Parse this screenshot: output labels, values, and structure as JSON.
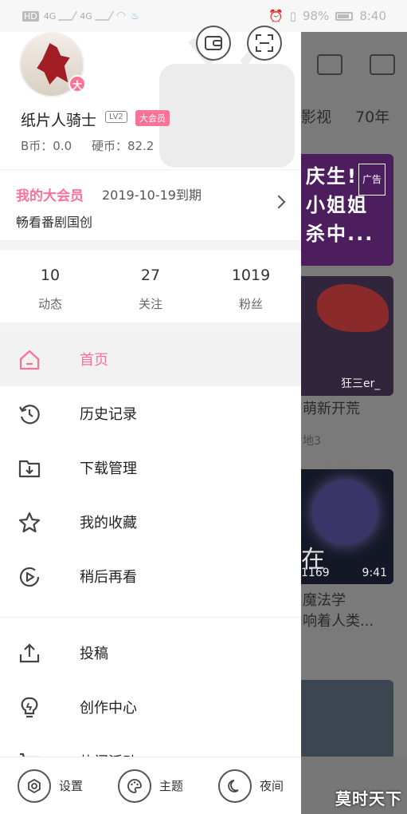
{
  "status_bar": {
    "left": [
      "HD",
      "4G",
      "4G"
    ],
    "battery": "98%",
    "time": "8:40"
  },
  "profile": {
    "username": "纸片人骑士",
    "level": "LV2",
    "vip_tag": "大会员",
    "avatar_badge": "大",
    "bcoin": "B币：0.0",
    "coin": "硬币：82.2"
  },
  "vip": {
    "title": "我的大会员",
    "expiry": "2019-10-19到期",
    "desc": "畅看番剧国创"
  },
  "stats": [
    {
      "num": "10",
      "label": "动态"
    },
    {
      "num": "27",
      "label": "关注"
    },
    {
      "num": "1019",
      "label": "粉丝"
    }
  ],
  "menu": [
    {
      "label": "首页",
      "icon": "home-icon"
    },
    {
      "label": "历史记录",
      "icon": "history-icon"
    },
    {
      "label": "下载管理",
      "icon": "download-folder-icon"
    },
    {
      "label": "我的收藏",
      "icon": "star-icon"
    },
    {
      "label": "稍后再看",
      "icon": "watch-later-icon"
    },
    {
      "label": "投稿",
      "icon": "upload-icon"
    },
    {
      "label": "创作中心",
      "icon": "lightbulb-icon"
    },
    {
      "label": "热门活动",
      "icon": "cart-icon"
    }
  ],
  "bottom": {
    "settings": "设置",
    "theme": "主题",
    "night": "夜间"
  },
  "background": {
    "tabs": [
      "影视",
      "70年"
    ],
    "ad_text": [
      "庆生!",
      "小姐姐",
      "杀中..."
    ],
    "ad_tag": "广告",
    "card1_caption": "狂三er_",
    "card1_title": "萌新开荒",
    "card1_sub": "地3",
    "card2_overlay": "在",
    "card2_views": "1169",
    "card2_duration": "9:41",
    "card2_title": [
      "魔法学",
      "响着人类..."
    ]
  },
  "watermark": "莫时天下"
}
